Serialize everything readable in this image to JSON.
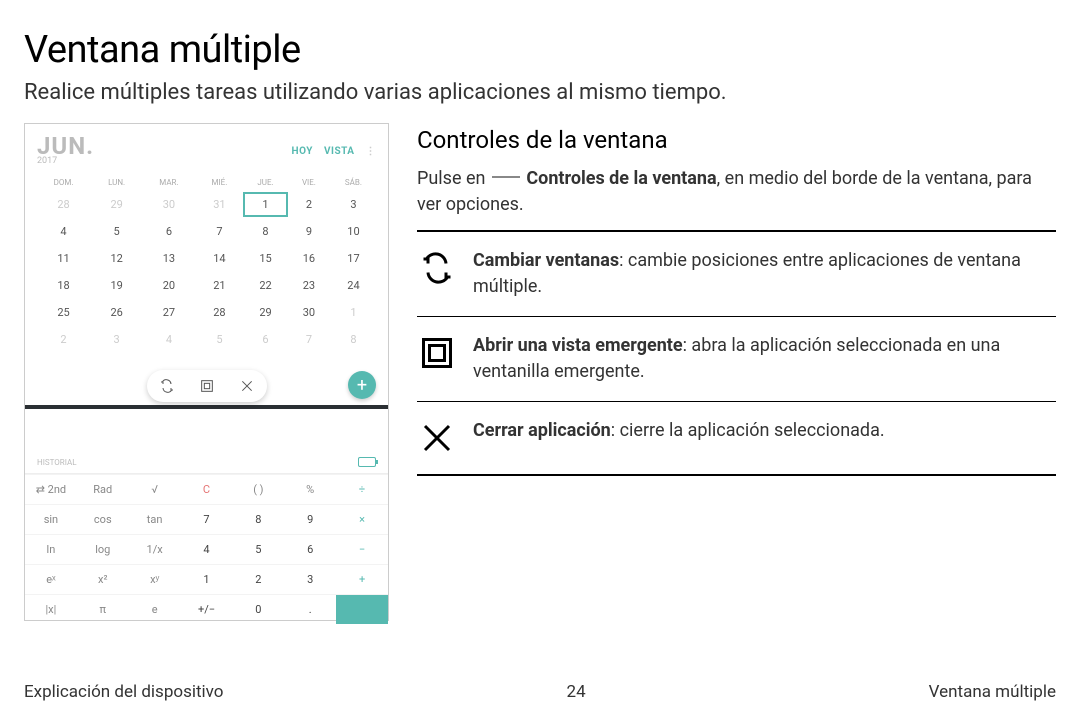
{
  "page": {
    "title": "Ventana múltiple",
    "subtitle": "Realice múltiples tareas utilizando varias aplicaciones al mismo tiempo."
  },
  "footer": {
    "left": "Explicación del dispositivo",
    "center": "24",
    "right": "Ventana múltiple"
  },
  "section": {
    "title": "Controles de la ventana",
    "intro_prefix": "Pulse en ",
    "intro_bold": "Controles de la ventana",
    "intro_suffix": ", en medio del borde de la ventana, para ver opciones."
  },
  "controls": [
    {
      "icon": "swap",
      "bold": "Cambiar ventanas",
      "text": ": cambie posiciones entre aplicaciones de ventana múltiple."
    },
    {
      "icon": "popup",
      "bold": "Abrir una vista emergente",
      "text": ": abra la aplicación seleccionada en una ventanilla emergente."
    },
    {
      "icon": "close",
      "bold": "Cerrar aplicación",
      "text": ": cierre la aplicación seleccionada."
    }
  ],
  "phone": {
    "month": "JUN.",
    "year": "2017",
    "tabs": [
      "HOY",
      "VISTA"
    ],
    "dow": [
      "DOM.",
      "LUN.",
      "MAR.",
      "MIÉ.",
      "JUE.",
      "VIE.",
      "SÁB."
    ],
    "weeks": [
      [
        "28",
        "29",
        "30",
        "31",
        "1",
        "2",
        "3"
      ],
      [
        "4",
        "5",
        "6",
        "7",
        "8",
        "9",
        "10"
      ],
      [
        "11",
        "12",
        "13",
        "14",
        "15",
        "16",
        "17"
      ],
      [
        "18",
        "19",
        "20",
        "21",
        "22",
        "23",
        "24"
      ],
      [
        "25",
        "26",
        "27",
        "28",
        "29",
        "30",
        "1"
      ],
      [
        "2",
        "3",
        "4",
        "5",
        "6",
        "7",
        "8"
      ]
    ],
    "fab": "+",
    "historial": "HISTORIAL",
    "calc_rows": [
      [
        "⇄ 2nd",
        "Rad",
        "√",
        "C",
        "( )",
        "%",
        "÷"
      ],
      [
        "sin",
        "cos",
        "tan",
        "7",
        "8",
        "9",
        "×"
      ],
      [
        "ln",
        "log",
        "1/x",
        "4",
        "5",
        "6",
        "−"
      ],
      [
        "eˣ",
        "x²",
        "xʸ",
        "1",
        "2",
        "3",
        "+"
      ],
      [
        "|x|",
        "π",
        "e",
        "+/−",
        "0",
        ".",
        "="
      ]
    ]
  }
}
